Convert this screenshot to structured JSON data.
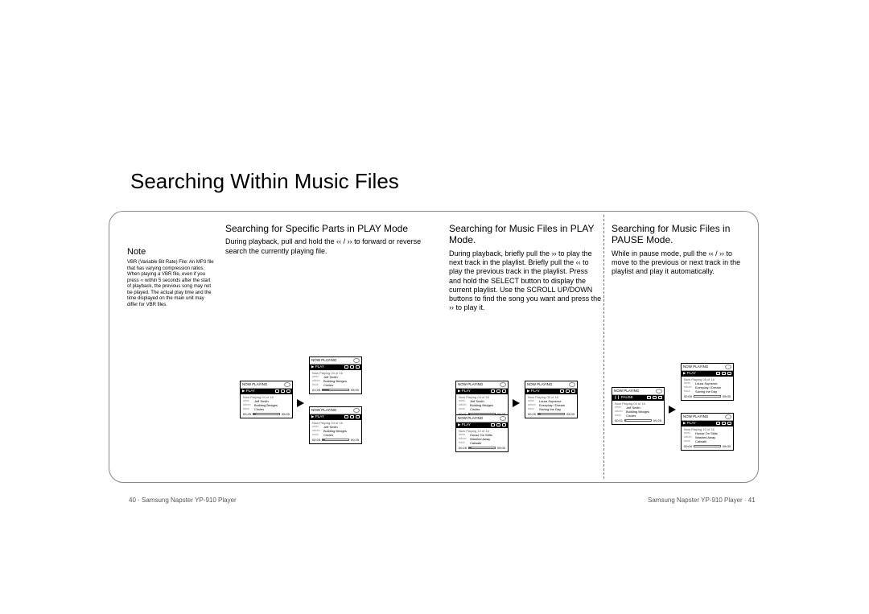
{
  "page_title": "Searching Within Music Files",
  "note": {
    "heading": "Note",
    "body": "VBR (Variable Bit Rate) File: An MP3 file that has varying compression ratios. When playing a VBR file, even if you press ‹‹ within 5 seconds after the start of playback, the previous song may not be played. The actual play time and the time displayed on the main unit may differ for VBR files."
  },
  "section1": {
    "heading": "Searching for Specific Parts in PLAY Mode",
    "body": "During playback, pull and hold the ‹‹ / ›› to forward or reverse search the currently playing file."
  },
  "section2": {
    "heading": "Searching for Music Files in PLAY Mode.",
    "body": "During playback, briefly pull the ›› to play the next track in the playlist. Briefly pull the ‹‹ to play the previous track in the playlist. Press and hold the SELECT button to display the current playlist. Use the SCROLL UP/DOWN buttons to find the song you want and press the ›› to play it."
  },
  "section3": {
    "heading": "Searching for Music Files in PAUSE Mode.",
    "body": "While in pause mode, pull the ‹‹ / ›› to move to the previous or next track in the playlist and play it automatically."
  },
  "footer_left": "40 · Samsung Napster YP-910 Player",
  "footer_right": "Samsung Napster YP-910 Player · 41",
  "screens": {
    "np_label": "NOW PLAYING",
    "play_label": "▶ PLAY",
    "pause_label": "❙❙ PAUSE",
    "labels": {
      "artist": "artist",
      "album": "album",
      "track": "track"
    },
    "s1": {
      "source": {
        "nowplaying": "Now Playing 04 of 16",
        "artist": "Jeff Smith",
        "album": "Building Bridges",
        "track": "Circles",
        "t1": "00:25",
        "t2": "05:00",
        "fill": "10%"
      },
      "dest_a": {
        "nowplaying": "Now Playing 04 of 16",
        "artist": "Jeff Smith",
        "album": "Building Bridges",
        "track": "Circles",
        "t1": "01:25",
        "t2": "05:00",
        "fill": "26%"
      },
      "dest_b": {
        "nowplaying": "Now Playing 04 of 16",
        "artist": "Jeff Smith",
        "album": "Building Bridges",
        "track": "Circles",
        "t1": "00:25",
        "t2": "00:25",
        "fill": "10%"
      }
    },
    "s2": {
      "source": {
        "nowplaying": "Now Playing 04 of 16",
        "artist": "Jeff Smith",
        "album": "Building Bridges",
        "track": "Circles",
        "t1": "00:01",
        "t2": "00:25",
        "fill": "4%"
      },
      "dest_a": {
        "nowplaying": "Now Playing 05 of 16",
        "artist": "Laura Supreme",
        "album": "Everyday I Dream",
        "track": "Saving the Day",
        "t1": "00:25",
        "t2": "05:00",
        "fill": "10%"
      },
      "dest_b": {
        "nowplaying": "Now Playing 10 of 16",
        "artist": "House On Stilts",
        "album": "Washed Away",
        "track": "Catwalk",
        "t1": "00:25",
        "t2": "05:00",
        "fill": "10%"
      }
    },
    "s3": {
      "source": {
        "nowplaying": "Now Playing 04 of 16",
        "artist": "Jeff Smith",
        "album": "Building Bridges",
        "track": "Circles",
        "t1": "00:01",
        "t2": "00:25",
        "fill": "4%"
      },
      "dest_a": {
        "nowplaying": "Now Playing 05 of 16",
        "artist": "Laura Supreme",
        "album": "Everyday I Dream",
        "track": "Saving the Day",
        "t1": "00:00",
        "t2": "05:00",
        "fill": "0%"
      },
      "dest_b": {
        "nowplaying": "Now Playing 10 of 16",
        "artist": "House On Stilts",
        "album": "Washed Away",
        "track": "Catwalk",
        "t1": "00:00",
        "t2": "05:00",
        "fill": "0%"
      }
    }
  }
}
